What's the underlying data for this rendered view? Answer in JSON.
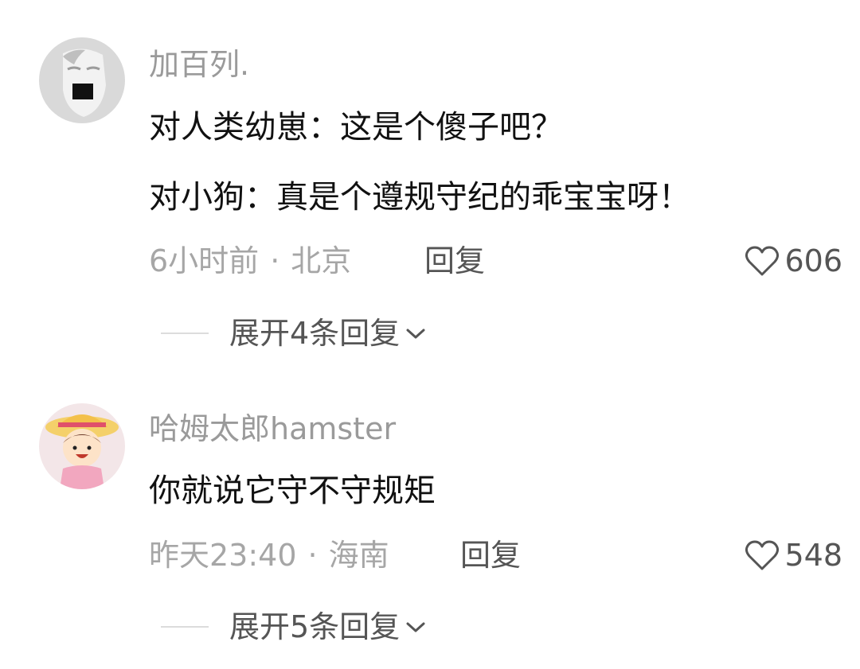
{
  "comments": [
    {
      "username": "加百列.",
      "avatar_icon": "statue-avatar",
      "lines": [
        "对人类幼崽：这是个傻子吧？",
        "对小狗：真是个遵规守纪的乖宝宝呀！"
      ],
      "time": "6小时前",
      "separator": "·",
      "location": "北京",
      "reply_label": "回复",
      "like_icon": "heart-outline-icon",
      "like_count": "606",
      "expand_label": "展开4条回复"
    },
    {
      "username": "哈姆太郎hamster",
      "avatar_icon": "cartoon-girl-avatar",
      "lines": [
        "你就说它守不守规矩"
      ],
      "time": "昨天23:40",
      "separator": "·",
      "location": "海南",
      "reply_label": "回复",
      "like_icon": "heart-outline-icon",
      "like_count": "548",
      "expand_label": "展开5条回复"
    }
  ],
  "colors": {
    "username": "#9a9a9a",
    "body_text": "#111111",
    "meta_text": "#a6a6a6",
    "action_text": "#555555"
  }
}
